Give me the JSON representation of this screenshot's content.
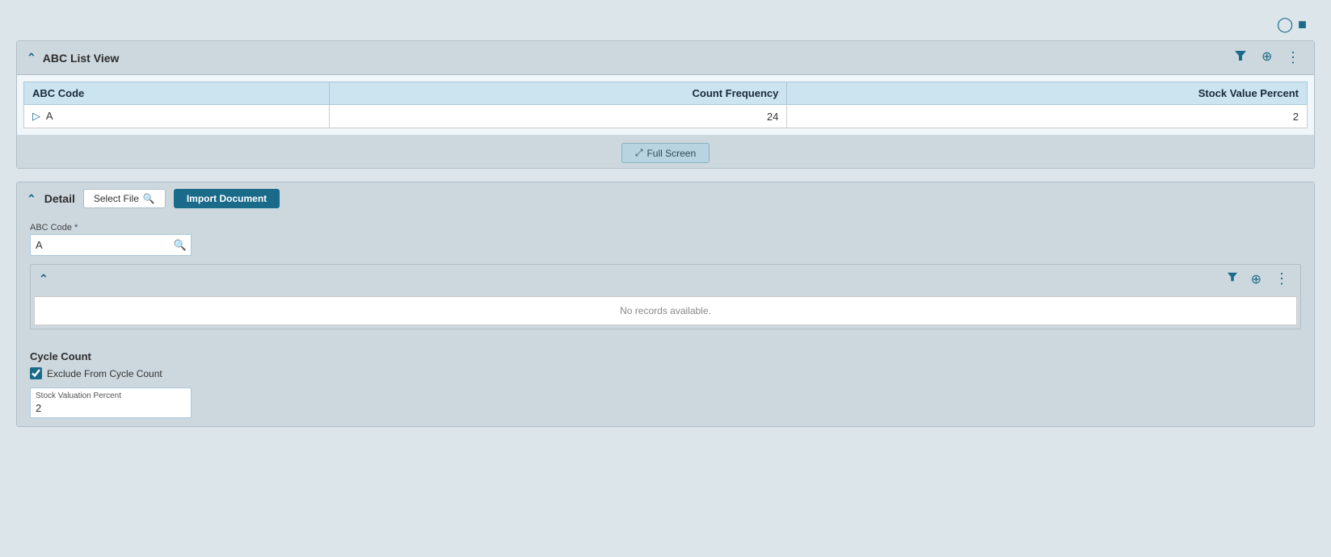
{
  "topBar": {
    "icons": [
      "circle-icon",
      "square-icon"
    ]
  },
  "abcListView": {
    "title": "ABC List View",
    "table": {
      "columns": [
        "ABC Code",
        "Count Frequency",
        "Stock Value Percent"
      ],
      "rows": [
        {
          "abcCode": "A",
          "countFrequency": "24",
          "stockValuePercent": "2"
        }
      ]
    },
    "fullScreenLabel": "Full Screen"
  },
  "detail": {
    "title": "Detail",
    "selectFileLabel": "Select File",
    "importDocumentLabel": "Import Document",
    "abcCodeLabel": "ABC Code *",
    "abcCodeValue": "A",
    "noRecordsLabel": "No records available.",
    "cycleCount": {
      "title": "Cycle Count",
      "excludeLabel": "Exclude From Cycle Count",
      "excludeChecked": true,
      "stockValuationLabel": "Stock Valuation Percent",
      "stockValuationValue": "2"
    }
  }
}
